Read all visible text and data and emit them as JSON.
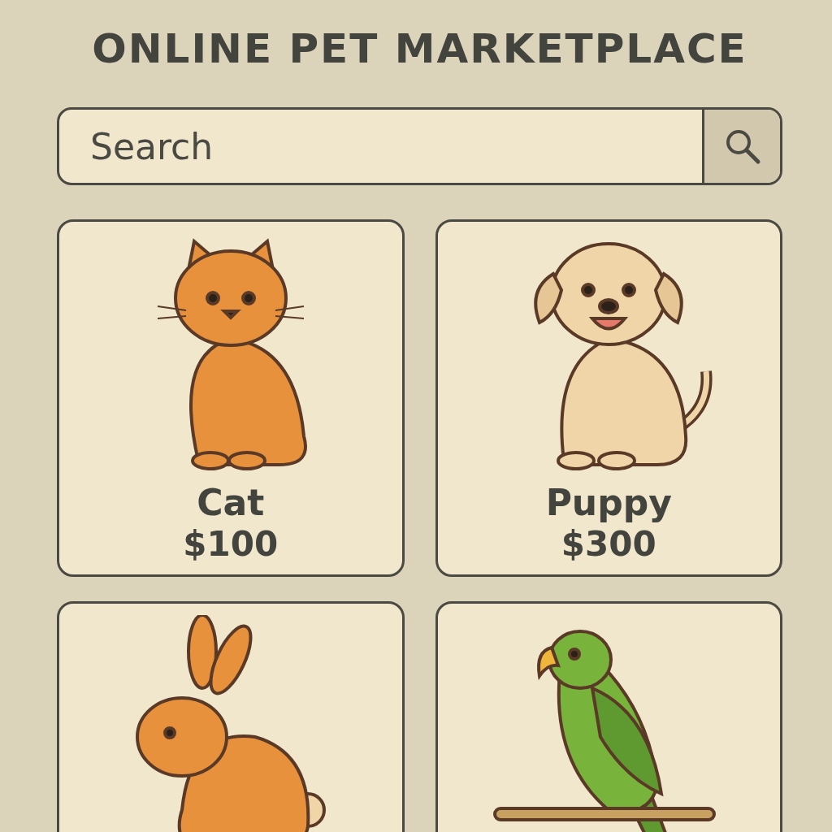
{
  "title": "ONLINE PET MARKETPLACE",
  "search": {
    "placeholder": "Search"
  },
  "pets": [
    {
      "kind": "cat",
      "name": "Cat",
      "price": "$100"
    },
    {
      "kind": "puppy",
      "name": "Puppy",
      "price": "$300"
    },
    {
      "kind": "rabbit"
    },
    {
      "kind": "parrot"
    }
  ]
}
